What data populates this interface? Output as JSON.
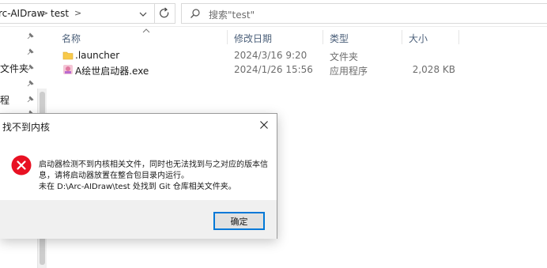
{
  "address_bar": {
    "crumbs": [
      "rc-AIDraw",
      "test"
    ],
    "separator": ">",
    "refresh_icon": "refresh-icon",
    "dropdown_icon": "chevron-down-icon"
  },
  "search": {
    "placeholder": "搜索\"test\"",
    "icon": "search-icon"
  },
  "nav": {
    "labels": [
      {
        "text": "文件夹"
      },
      {
        "text": "程"
      }
    ],
    "pin_icon": "pin-icon"
  },
  "file_list": {
    "columns": [
      "名称",
      "修改日期",
      "类型",
      "大小"
    ],
    "rows": [
      {
        "name": ".launcher",
        "date": "2024/3/16 9:20",
        "type": "文件夹",
        "size": "",
        "icon": "folder-icon"
      },
      {
        "name": "A绘世启动器.exe",
        "date": "2024/1/26 15:56",
        "type": "应用程序",
        "size": "2,028 KB",
        "icon": "app-icon"
      }
    ]
  },
  "dialog": {
    "title": "找不到内核",
    "icon": "error-icon",
    "message_lines": [
      "启动器检测不到内核相关文件，同时也无法找到与之对应的版本信",
      "息，请将启动器放置在整合包目录内运行。",
      "未在 D:\\Arc-AIDraw\\test 处找到 Git 仓库相关文件夹。"
    ],
    "ok_label": "确定"
  },
  "colors": {
    "error_red": "#e81123",
    "focus_blue": "#0078d7",
    "folder_yellow": "#f8c94a",
    "header_text": "#4c607a"
  }
}
